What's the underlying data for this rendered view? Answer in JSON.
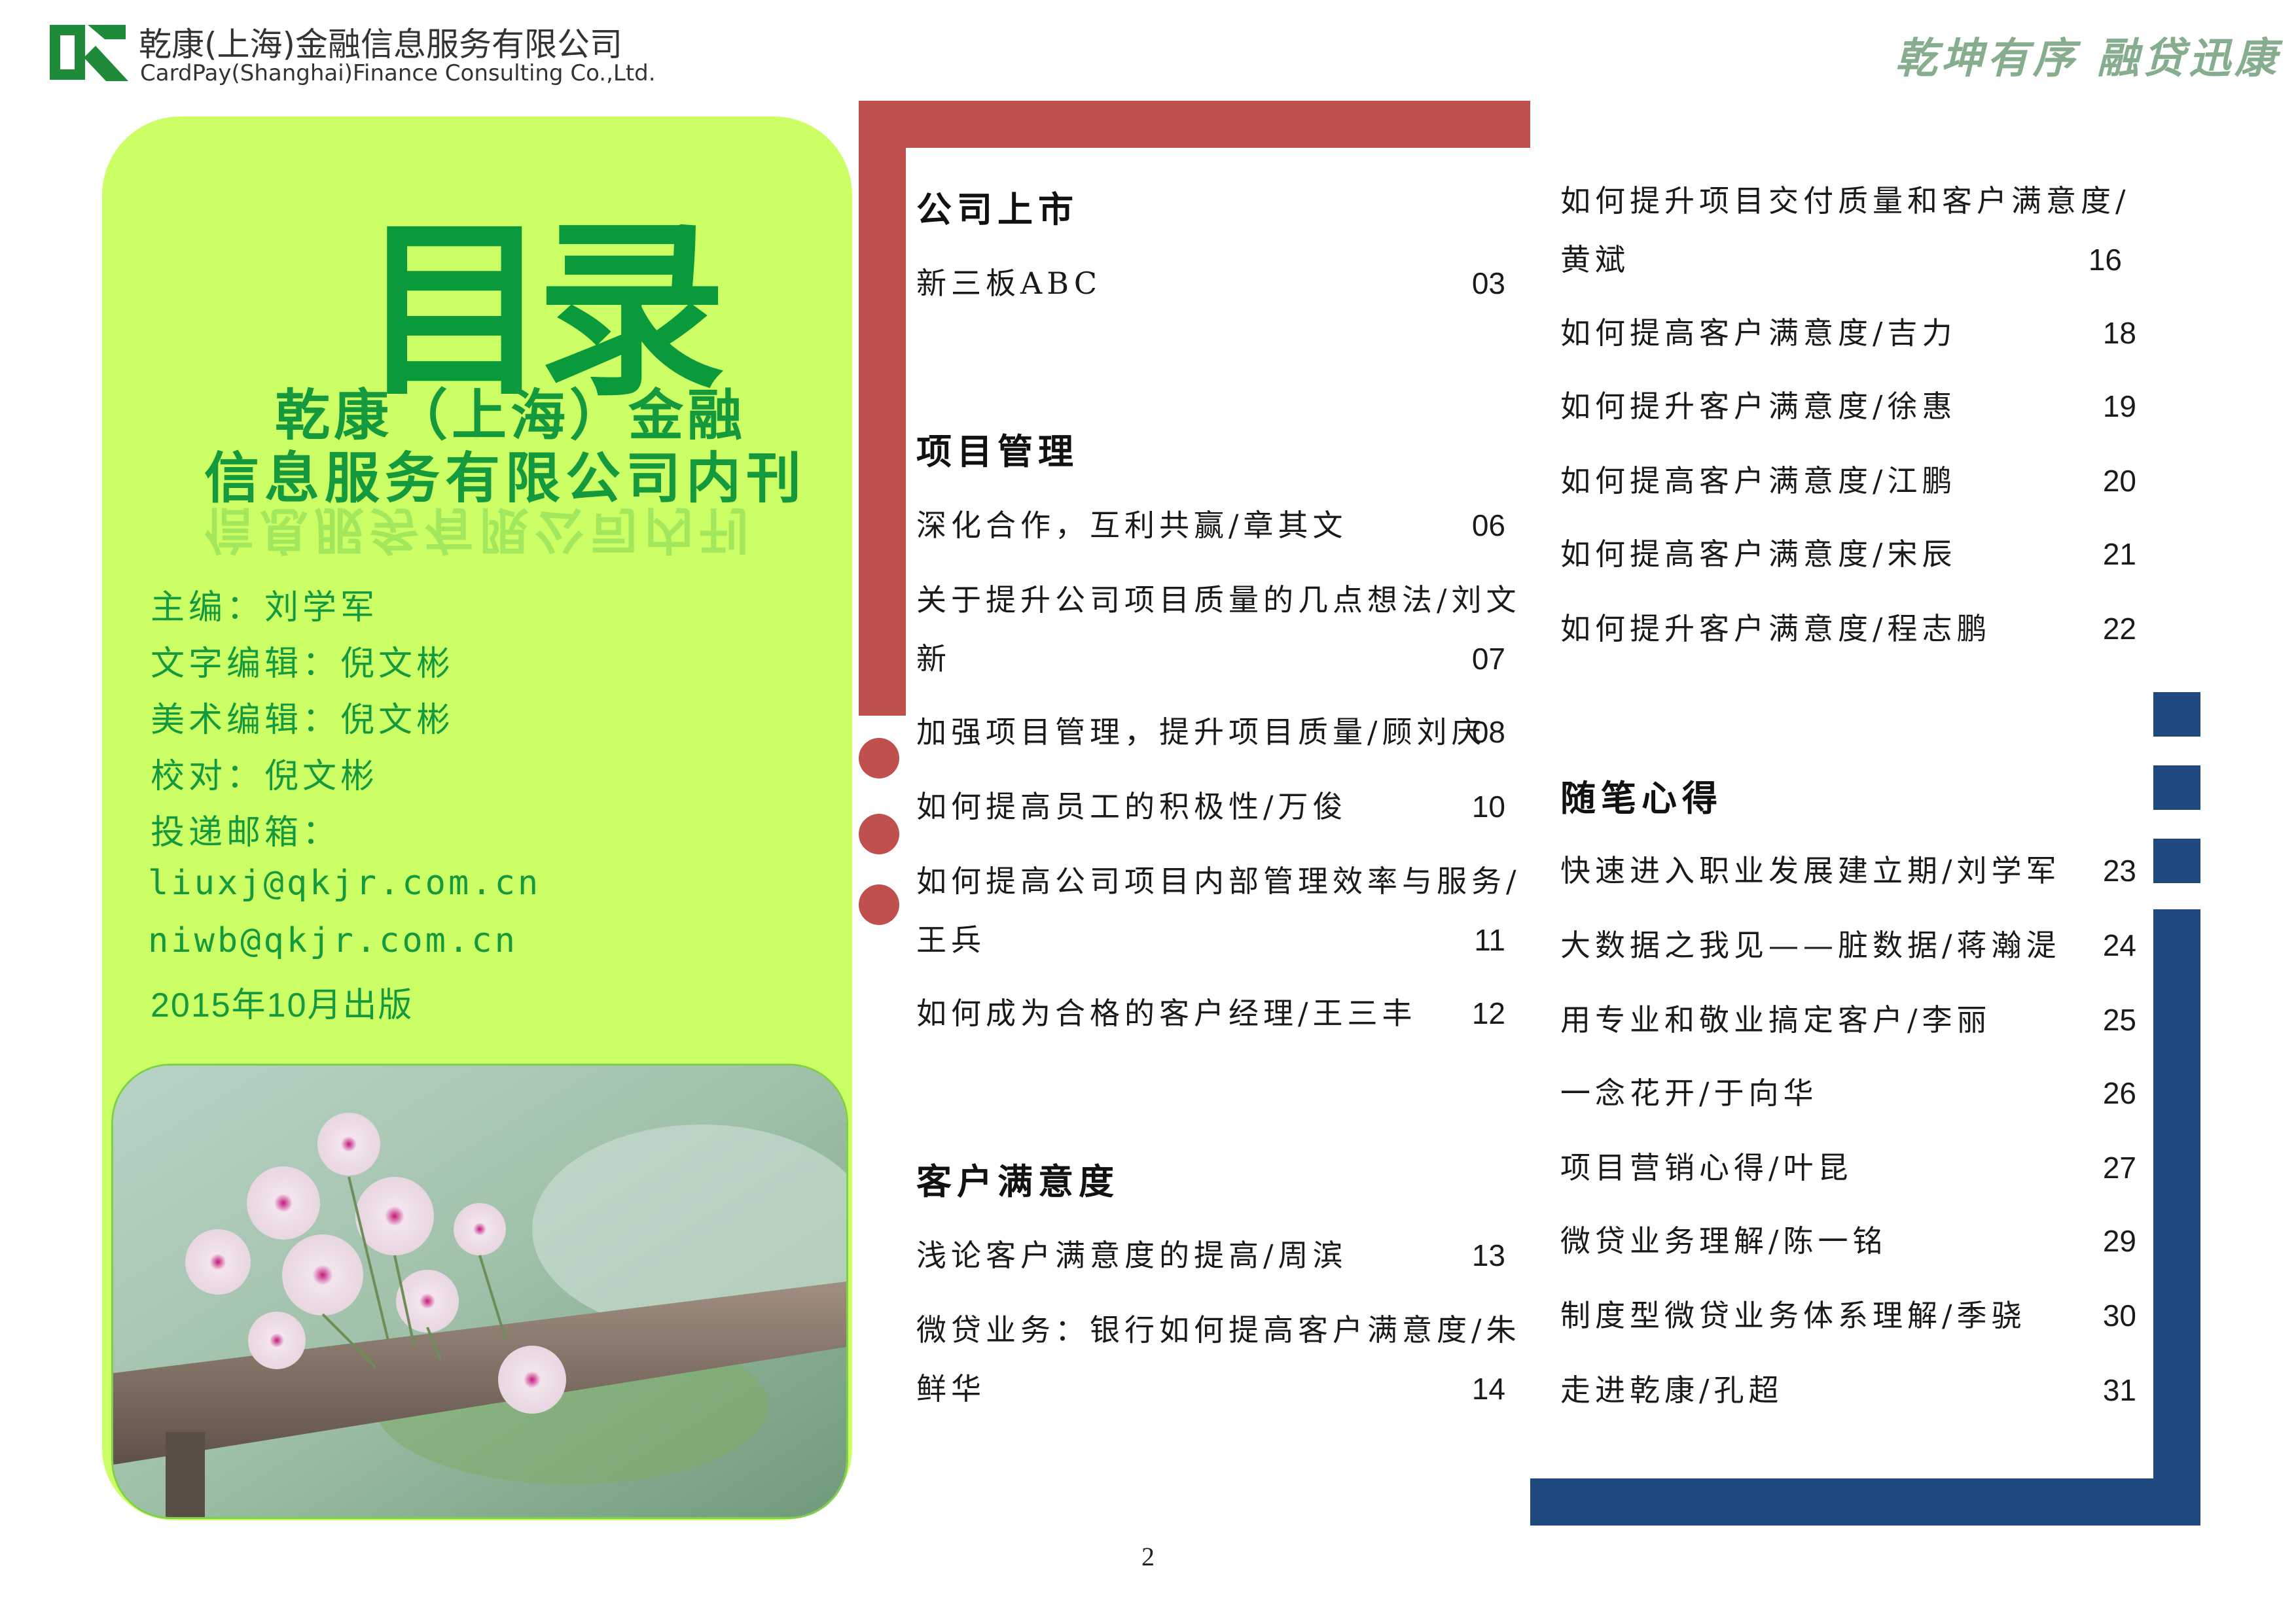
{
  "header": {
    "company_cn": "乾康(上海)金融信息服务有限公司",
    "company_en": "CardPay(Shanghai)Finance Consulting Co.,Ltd.",
    "slogan": "乾坤有序 融贷迅康"
  },
  "panel": {
    "toc_title": "目录",
    "publication_line1": "乾康（上海）金融",
    "publication_line2": "信息服务有限公司内刊",
    "credits": [
      "主编：刘学军",
      "文字编辑：倪文彬",
      "美术编辑：倪文彬",
      "校对：倪文彬",
      "投递邮箱：",
      "liuxj@qkjr.com.cn",
      "niwb@qkjr.com.cn",
      "2015年10月出版"
    ]
  },
  "toc": {
    "sections": [
      {
        "title": "公司上市",
        "entries": [
          {
            "title": "新三板ABC",
            "page": "03"
          }
        ]
      },
      {
        "title": "项目管理",
        "entries": [
          {
            "title": "深化合作，互利共赢/章其文",
            "page": "06"
          },
          {
            "title": "关于提升公司项目质量的几点想法/刘文新",
            "page": "07"
          },
          {
            "title": "加强项目管理，提升项目质量/顾刘庆",
            "page": "08"
          },
          {
            "title": "如何提高员工的积极性/万俊",
            "page": "10"
          },
          {
            "title": "如何提高公司项目内部管理效率与服务/王兵",
            "page": "11"
          },
          {
            "title": "如何成为合格的客户经理/王三丰",
            "page": "12"
          }
        ]
      },
      {
        "title": "客户满意度",
        "entries": [
          {
            "title": "浅论客户满意度的提高/周滨",
            "page": "13"
          },
          {
            "title": "微贷业务：银行如何提高客户满意度/朱鲜华",
            "page": "14"
          },
          {
            "title": "如何提升项目交付质量和客户满意度/黄斌",
            "page": "16"
          },
          {
            "title": "如何提高客户满意度/吉力",
            "page": "18"
          },
          {
            "title": "如何提升客户满意度/徐惠",
            "page": "19"
          },
          {
            "title": "如何提高客户满意度/江鹏",
            "page": "20"
          },
          {
            "title": "如何提高客户满意度/宋辰",
            "page": "21"
          },
          {
            "title": "如何提升客户满意度/程志鹏",
            "page": "22"
          }
        ]
      },
      {
        "title": "随笔心得",
        "entries": [
          {
            "title": "快速进入职业发展建立期/刘学军",
            "page": "23"
          },
          {
            "title": "大数据之我见——脏数据/蒋瀚湜",
            "page": "24"
          },
          {
            "title": "用专业和敬业搞定客户/李丽",
            "page": "25"
          },
          {
            "title": "一念花开/于向华",
            "page": "26"
          },
          {
            "title": "项目营销心得/叶昆",
            "page": "27"
          },
          {
            "title": "微贷业务理解/陈一铭",
            "page": "29"
          },
          {
            "title": "制度型微贷业务体系理解/季骁",
            "page": "30"
          },
          {
            "title": "走进乾康/孔超",
            "page": "31"
          }
        ]
      }
    ]
  },
  "footer": {
    "page_number": "2"
  },
  "colors": {
    "green_panel": "#ccff66",
    "title_green": "#0a9a3c",
    "accent_red": "#c0504d",
    "accent_blue": "#1f497d"
  },
  "icons": [
    "company-logo-icon"
  ]
}
